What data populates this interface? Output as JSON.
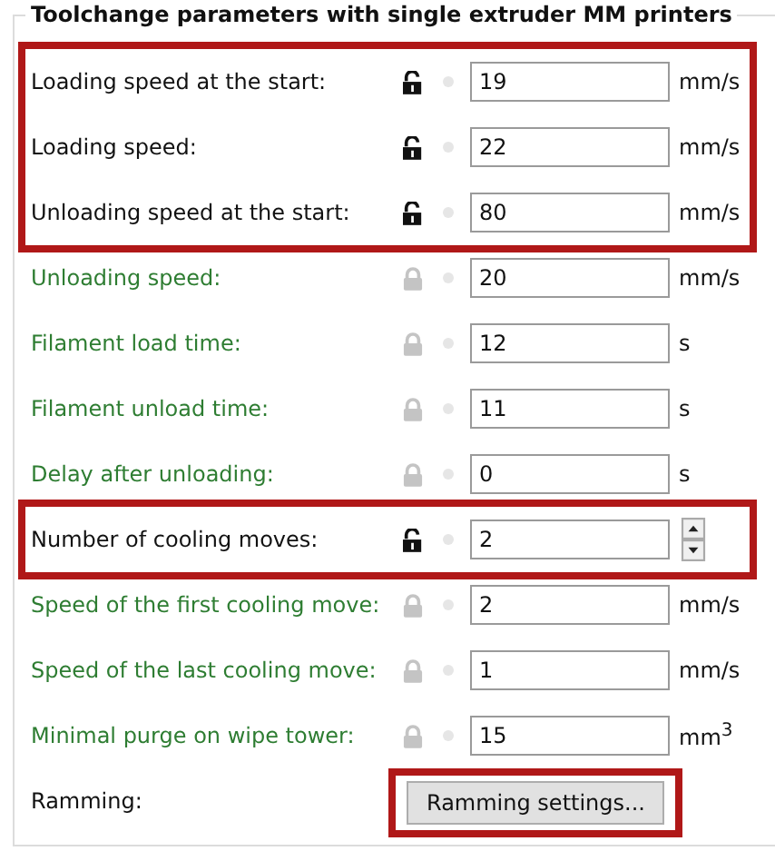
{
  "group": {
    "title": "Toolchange parameters with single extruder MM printers"
  },
  "rows": [
    {
      "kind": "field",
      "label": "Loading speed at the start:",
      "unlocked": true,
      "highlighted": true,
      "value": "19",
      "unit": "mm/s"
    },
    {
      "kind": "field",
      "label": "Loading speed:",
      "unlocked": true,
      "highlighted": true,
      "value": "22",
      "unit": "mm/s"
    },
    {
      "kind": "field",
      "label": "Unloading speed at the start:",
      "unlocked": true,
      "highlighted": true,
      "value": "80",
      "unit": "mm/s"
    },
    {
      "kind": "field",
      "label": "Unloading speed:",
      "unlocked": false,
      "highlighted": false,
      "value": "20",
      "unit": "mm/s"
    },
    {
      "kind": "field",
      "label": "Filament load time:",
      "unlocked": false,
      "highlighted": false,
      "value": "12",
      "unit": "s"
    },
    {
      "kind": "field",
      "label": "Filament unload time:",
      "unlocked": false,
      "highlighted": false,
      "value": "11",
      "unit": "s"
    },
    {
      "kind": "field",
      "label": "Delay after unloading:",
      "unlocked": false,
      "highlighted": false,
      "value": "0",
      "unit": "s"
    },
    {
      "kind": "spin",
      "label": "Number of cooling moves:",
      "unlocked": true,
      "highlighted": true,
      "value": "2"
    },
    {
      "kind": "field",
      "label": "Speed of the first cooling move:",
      "unlocked": false,
      "highlighted": false,
      "value": "2",
      "unit": "mm/s"
    },
    {
      "kind": "field",
      "label": "Speed of the last cooling move:",
      "unlocked": false,
      "highlighted": false,
      "value": "1",
      "unit": "mm/s"
    },
    {
      "kind": "field",
      "label": "Minimal purge on wipe tower:",
      "unlocked": false,
      "highlighted": false,
      "value": "15",
      "unit": "mm$^{3}$"
    },
    {
      "kind": "button",
      "label": "Ramming:",
      "button": "Ramming settings...",
      "highlighted": true
    }
  ]
}
